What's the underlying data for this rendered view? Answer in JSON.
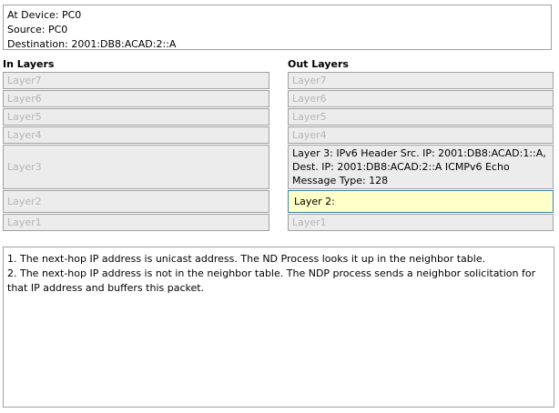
{
  "device_info": {
    "at_device": "At Device: PC0",
    "source": "Source: PC0",
    "destination": "Destination: 2001:DB8:ACAD:2::A"
  },
  "in_layers": {
    "header": "In Layers",
    "layers": [
      {
        "label": "Layer7"
      },
      {
        "label": "Layer6"
      },
      {
        "label": "Layer5"
      },
      {
        "label": "Layer4"
      },
      {
        "label": "Layer3"
      },
      {
        "label": "Layer2"
      },
      {
        "label": "Layer1"
      }
    ]
  },
  "out_layers": {
    "header": "Out Layers",
    "layers": [
      {
        "label": "Layer7"
      },
      {
        "label": "Layer6"
      },
      {
        "label": "Layer5"
      },
      {
        "label": "Layer4"
      },
      {
        "label": "Layer 3: IPv6 Header Src. IP: 2001:DB8:ACAD:1::A, Dest. IP: 2001:DB8:ACAD:2::A ICMPv6 Echo Message Type: 128"
      },
      {
        "label": "Layer 2:"
      },
      {
        "label": "Layer1"
      }
    ]
  },
  "details": {
    "lines": [
      "1. The next-hop IP address is unicast address. The ND Process looks it up in the neighbor table.",
      "2. The next-hop IP address is not in the neighbor table. The NDP process sends a neighbor solicitation for that IP address and buffers this packet."
    ]
  },
  "colors": {
    "inactive_text": "#b6b6b6",
    "layer_background": "#ececec",
    "selected_background": "#ffffc8",
    "selected_border": "#3c7fb1"
  }
}
